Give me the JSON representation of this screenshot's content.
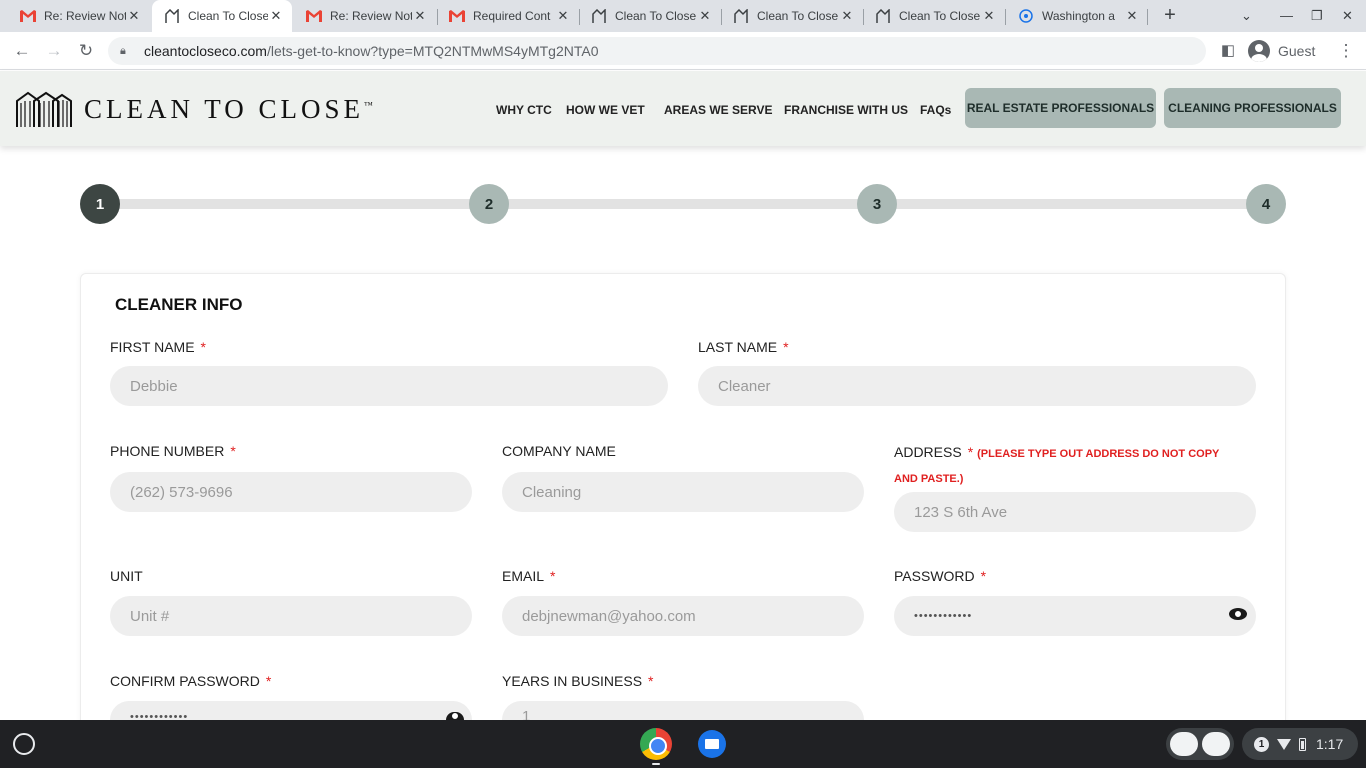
{
  "browser": {
    "tabs": [
      {
        "title": "Re: Review Not",
        "icon": "gmail-icon"
      },
      {
        "title": "Clean To Close",
        "icon": "ctc-icon",
        "active": true
      },
      {
        "title": "Re: Review Not",
        "icon": "gmail-icon"
      },
      {
        "title": "Required Cont",
        "icon": "gmail-icon"
      },
      {
        "title": "Clean To Close",
        "icon": "ctc-icon"
      },
      {
        "title": "Clean To Close",
        "icon": "ctc-icon"
      },
      {
        "title": "Clean To Close",
        "icon": "ctc-icon"
      },
      {
        "title": "Washington a",
        "icon": "site-icon"
      }
    ],
    "url_host": "cleantocloseco.com",
    "url_path": "/lets-get-to-know?type=MTQ2NTMwMS4yMTg2NTA0",
    "profile_label": "Guest"
  },
  "site": {
    "logo_text": "CLEAN TO CLOSE",
    "logo_tm": "™",
    "nav": [
      "WHY CTC",
      "HOW WE VET",
      "AREAS WE SERVE",
      "FRANCHISE WITH US",
      "FAQs"
    ],
    "cta_real_estate": "REAL ESTATE PROFESSIONALS",
    "cta_cleaning": "CLEANING PROFESSIONALS"
  },
  "stepper": {
    "steps": [
      "1",
      "2",
      "3",
      "4"
    ],
    "current_step": 1
  },
  "form": {
    "section_title": "CLEANER INFO",
    "required_mark": "*",
    "first_name": {
      "label": "FIRST NAME",
      "placeholder": "Debbie"
    },
    "last_name": {
      "label": "LAST NAME",
      "placeholder": "Cleaner"
    },
    "phone": {
      "label": "PHONE NUMBER",
      "placeholder": "(262) 573-9696"
    },
    "company": {
      "label": "COMPANY NAME",
      "placeholder": "Cleaning"
    },
    "address": {
      "label": "ADDRESS",
      "note": "(PLEASE TYPE OUT ADDRESS DO NOT COPY AND PASTE.)",
      "placeholder": "123 S 6th Ave"
    },
    "unit": {
      "label": "UNIT",
      "placeholder": "Unit #"
    },
    "email": {
      "label": "EMAIL",
      "placeholder": "debjnewman@yahoo.com"
    },
    "password": {
      "label": "PASSWORD",
      "value": "••••••••••••"
    },
    "confirm_password": {
      "label": "CONFIRM PASSWORD",
      "value": "••••••••••••"
    },
    "years_in_business": {
      "label": "YEARS IN BUSINESS",
      "placeholder": "1"
    }
  },
  "shelf": {
    "notification_count": "1",
    "time": "1:17"
  }
}
